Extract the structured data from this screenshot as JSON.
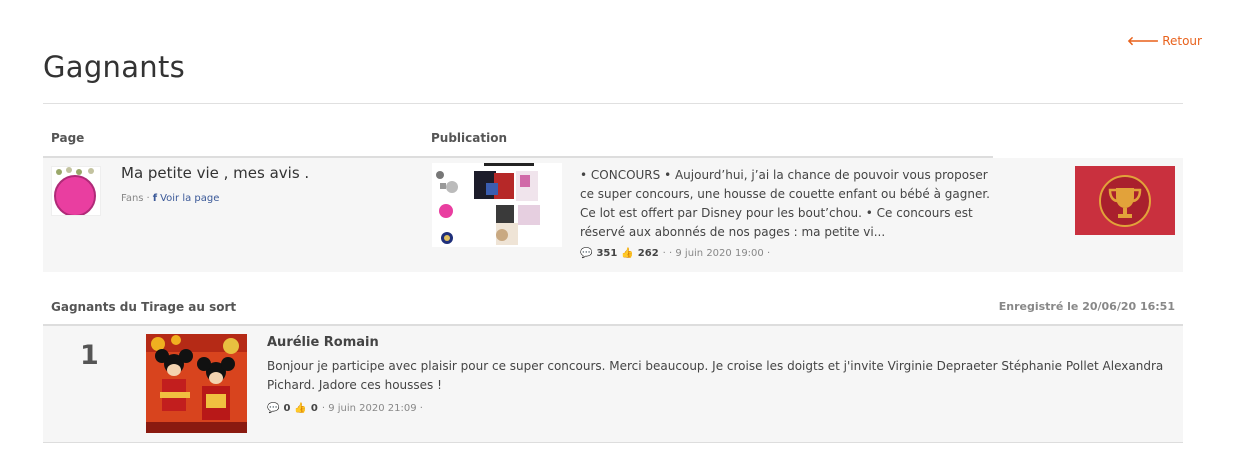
{
  "header": {
    "back_label": "Retour",
    "title": "Gagnants"
  },
  "columns": {
    "page": "Page",
    "publication": "Publication"
  },
  "page_info": {
    "name": "Ma petite vie , mes avis .",
    "fans_label": "Fans",
    "separator": "·",
    "link_label": "Voir la page"
  },
  "publication": {
    "text": "• CONCOURS • Aujourd’hui, j’ai la chance de pouvoir vous proposer ce super concours, une housse de couette enfant ou bébé à gagner. Ce lot est offert par Disney pour les bout’chou. • Ce concours est réservé aux abonnés de nos pages : ma petite vi...",
    "comments": "351",
    "likes": "262",
    "date": "· · 9 juin 2020 19:00 ·"
  },
  "winners_section": {
    "title": "Gagnants du Tirage au sort",
    "recorded": "Enregistré le 20/06/20 16:51"
  },
  "winner": {
    "rank": "1",
    "name": "Aurélie Romain",
    "comment": "Bonjour je participe avec plaisir pour ce super concours. Merci beaucoup. Je croise les doigts et j'invite Virginie Depraeter Stéphanie Pollet Alexandra Pichard. Jadore ces housses !",
    "comments": "0",
    "likes": "0",
    "date": "· 9 juin 2020 21:09 ·"
  },
  "colors": {
    "accent": "#e8621d",
    "trophy_bg": "#c9303e",
    "facebook": "#3b5998"
  },
  "icons": {
    "back": "arrow-left-icon",
    "facebook": "facebook-icon",
    "comments": "comment-icon",
    "likes": "thumbs-up-icon",
    "trophy": "trophy-icon"
  }
}
